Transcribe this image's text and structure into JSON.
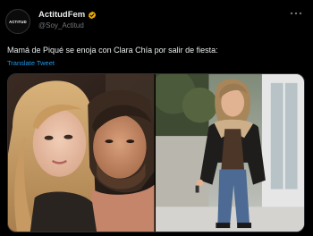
{
  "tweet": {
    "author_name": "ActitudFem",
    "author_handle": "@Soy_Actitud",
    "avatar_text": "ACTITUD",
    "text": "Mamá de Piqué se enoja con Clara Chía por salir de fiesta:",
    "translate_label": "Translate Tweet"
  },
  "colors": {
    "background": "#000000",
    "text": "#e7e9ea",
    "muted": "#71767b",
    "link": "#1d9bf0",
    "verified_badge": "#f4b400"
  },
  "icons": {
    "verified": "verified-badge-icon",
    "more": "more-options-icon"
  }
}
